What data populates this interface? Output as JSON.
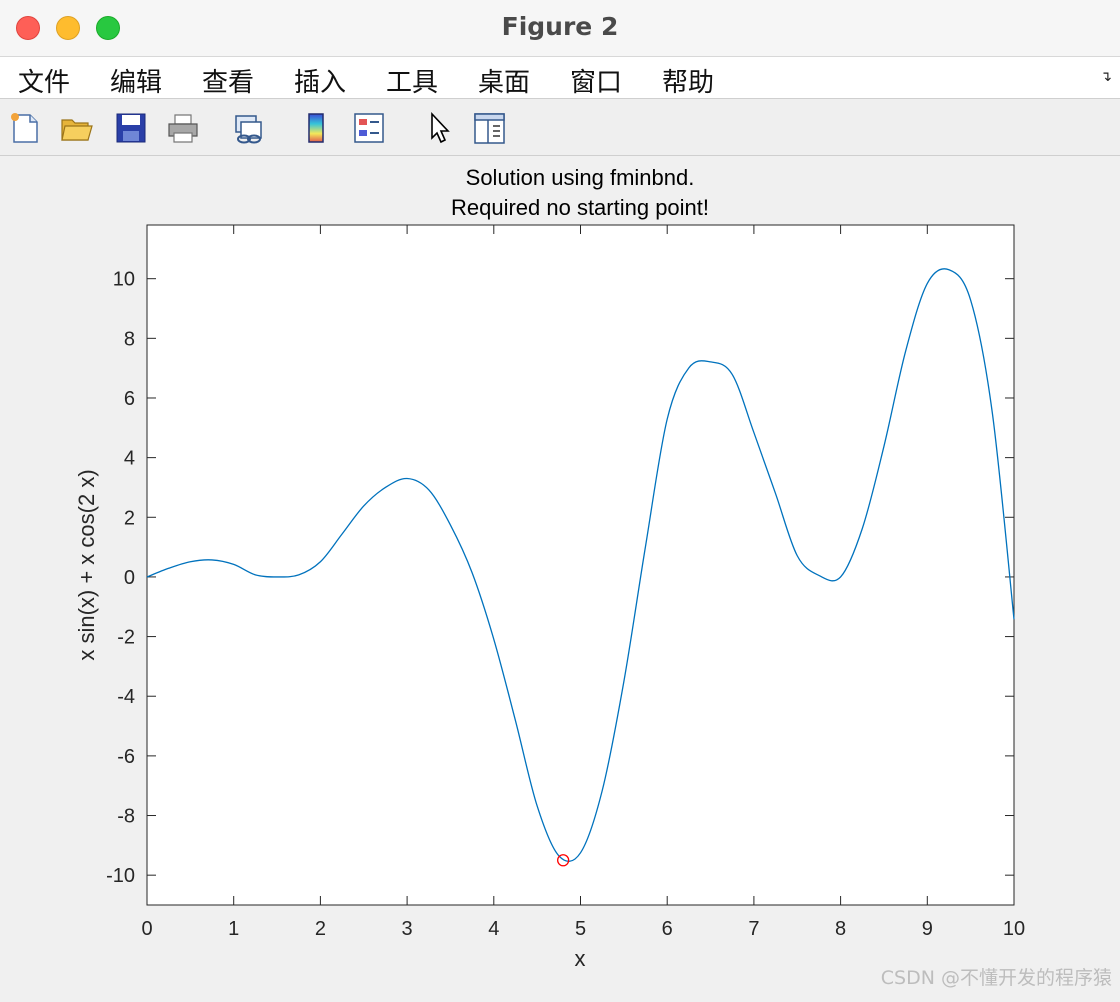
{
  "window": {
    "title": "Figure 2"
  },
  "menu": {
    "items": [
      "文件",
      "编辑",
      "查看",
      "插入",
      "工具",
      "桌面",
      "窗口",
      "帮助"
    ],
    "overflow_icon": "chevron-double-icon"
  },
  "toolbar": {
    "icons": [
      "new-figure-icon",
      "open-file-icon",
      "save-icon",
      "print-icon",
      "link-plot-icon",
      "colorbar-icon",
      "legend-icon",
      "edit-plot-icon",
      "property-inspector-icon"
    ]
  },
  "watermark": "CSDN @不懂开发的程序猿",
  "chart_data": {
    "type": "line",
    "title": [
      "Solution using fminbnd.",
      "Required no starting point!"
    ],
    "xlabel": "x",
    "ylabel": "x sin(x) + x cos(2 x)",
    "xlim": [
      0,
      10
    ],
    "ylim": [
      -11,
      11.8
    ],
    "xticks": [
      0,
      1,
      2,
      3,
      4,
      5,
      6,
      7,
      8,
      9,
      10
    ],
    "yticks": [
      -10,
      -8,
      -6,
      -4,
      -2,
      0,
      2,
      4,
      6,
      8,
      10
    ],
    "grid": false,
    "series": [
      {
        "name": "",
        "color": "#0072bd",
        "x": [
          0,
          0.25,
          0.5,
          0.75,
          1.0,
          1.25,
          1.5,
          1.75,
          2.0,
          2.25,
          2.5,
          2.75,
          3.0,
          3.25,
          3.5,
          3.75,
          4.0,
          4.25,
          4.5,
          4.75,
          5.0,
          5.25,
          5.5,
          5.75,
          6.0,
          6.25,
          6.5,
          6.75,
          7.0,
          7.25,
          7.5,
          7.75,
          8.0,
          8.25,
          8.5,
          8.75,
          9.0,
          9.25,
          9.5,
          9.75,
          10.0
        ],
        "y": [
          0,
          0.29,
          0.51,
          0.57,
          0.42,
          0.07,
          -0.0,
          0.07,
          0.51,
          1.44,
          2.38,
          3.0,
          3.3,
          2.92,
          1.74,
          0.14,
          -2.09,
          -4.82,
          -7.68,
          -9.35,
          -9.25,
          -7.17,
          -3.51,
          1.03,
          5.29,
          7.01,
          7.21,
          6.79,
          4.84,
          2.79,
          0.71,
          0.05,
          0.0,
          1.62,
          4.38,
          7.57,
          9.84,
          10.3,
          9.28,
          5.5,
          -1.42
        ]
      }
    ],
    "markers": [
      {
        "name": "minimum",
        "x": 4.8,
        "y": -9.5,
        "color": "#ff0000",
        "shape": "circle"
      }
    ]
  }
}
